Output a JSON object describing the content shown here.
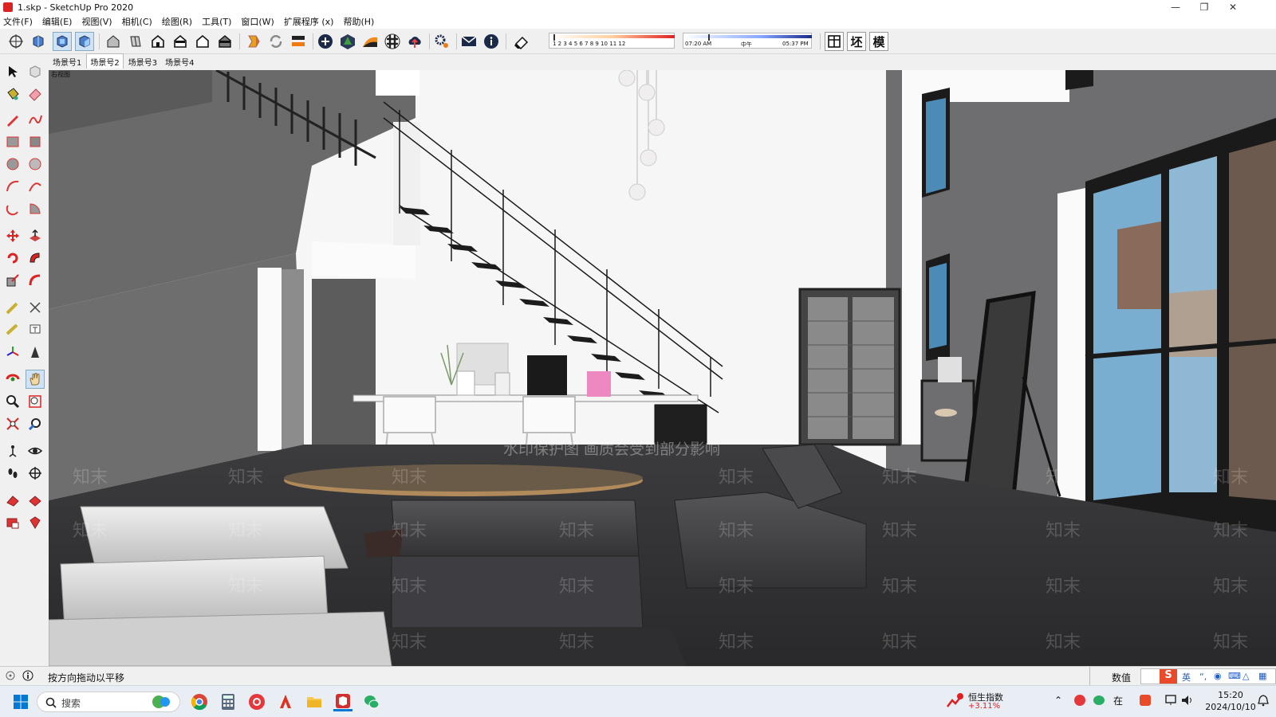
{
  "window": {
    "title": "1.skp - SketchUp Pro 2020"
  },
  "menu": [
    "文件(F)",
    "编辑(E)",
    "视图(V)",
    "相机(C)",
    "绘图(R)",
    "工具(T)",
    "窗口(W)",
    "扩展程序 (x)",
    "帮助(H)"
  ],
  "shadow_months": "1  2  3  4  5  6  7  8  9  10 11 12",
  "shadow_time": {
    "start": "07:20 AM",
    "mid": "中午",
    "end": "05:37 PM"
  },
  "right_buttons": [
    "坯",
    "模"
  ],
  "scenes": [
    {
      "label": "场景号1",
      "active": false
    },
    {
      "label": "场景号2",
      "active": true
    },
    {
      "label": "场景号3",
      "active": false
    },
    {
      "label": "场景号4",
      "active": false
    }
  ],
  "view_label": "右视图",
  "watermark": {
    "banner": "水印保护图 画质会受到部分影响",
    "tile": "知末"
  },
  "status": {
    "hint": "按方向拖动以平移",
    "measure_label": "数值"
  },
  "taskbar": {
    "search_placeholder": "搜索",
    "stock": {
      "name": "恒生指数",
      "change": "+3.11%"
    },
    "ime": "英",
    "time": "15:20",
    "date": "2024/10/10"
  },
  "colors": {
    "accent": "#0078d4",
    "stock_up": "#e02020"
  }
}
